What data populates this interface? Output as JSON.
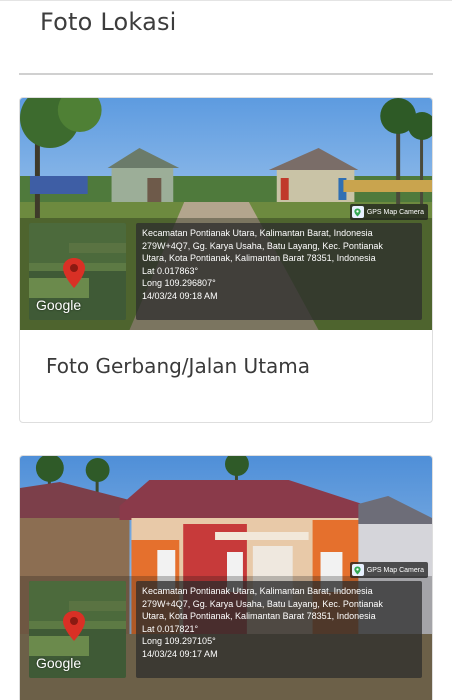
{
  "section": {
    "title": "Foto Lokasi"
  },
  "cards": [
    {
      "caption": "Foto Gerbang/Jalan Utama",
      "gps_badge": "GPS Map Camera",
      "map_logo": "Google",
      "info": {
        "line1": "Kecamatan Pontianak Utara, Kalimantan Barat, Indonesia",
        "line2": "279W+4Q7, Gg. Karya Usaha, Batu Layang, Kec. Pontianak",
        "line3": "Utara, Kota Pontianak, Kalimantan Barat 78351, Indonesia",
        "lat": "Lat 0.017863°",
        "long": "Long 109.296807°",
        "datetime": "14/03/24 09:18 AM"
      }
    },
    {
      "caption": "",
      "gps_badge": "GPS Map Camera",
      "map_logo": "Google",
      "info": {
        "line1": "Kecamatan Pontianak Utara, Kalimantan Barat, Indonesia",
        "line2": "279W+4Q7, Gg. Karya Usaha, Batu Layang, Kec. Pontianak",
        "line3": "Utara, Kota Pontianak, Kalimantan Barat 78351, Indonesia",
        "lat": "Lat 0.017821°",
        "long": "Long 109.297105°",
        "datetime": "14/03/24 09:17 AM"
      }
    }
  ],
  "colors": {
    "divider": "#d0d0d0",
    "card_border": "#dedede",
    "pin": "#d93025"
  }
}
